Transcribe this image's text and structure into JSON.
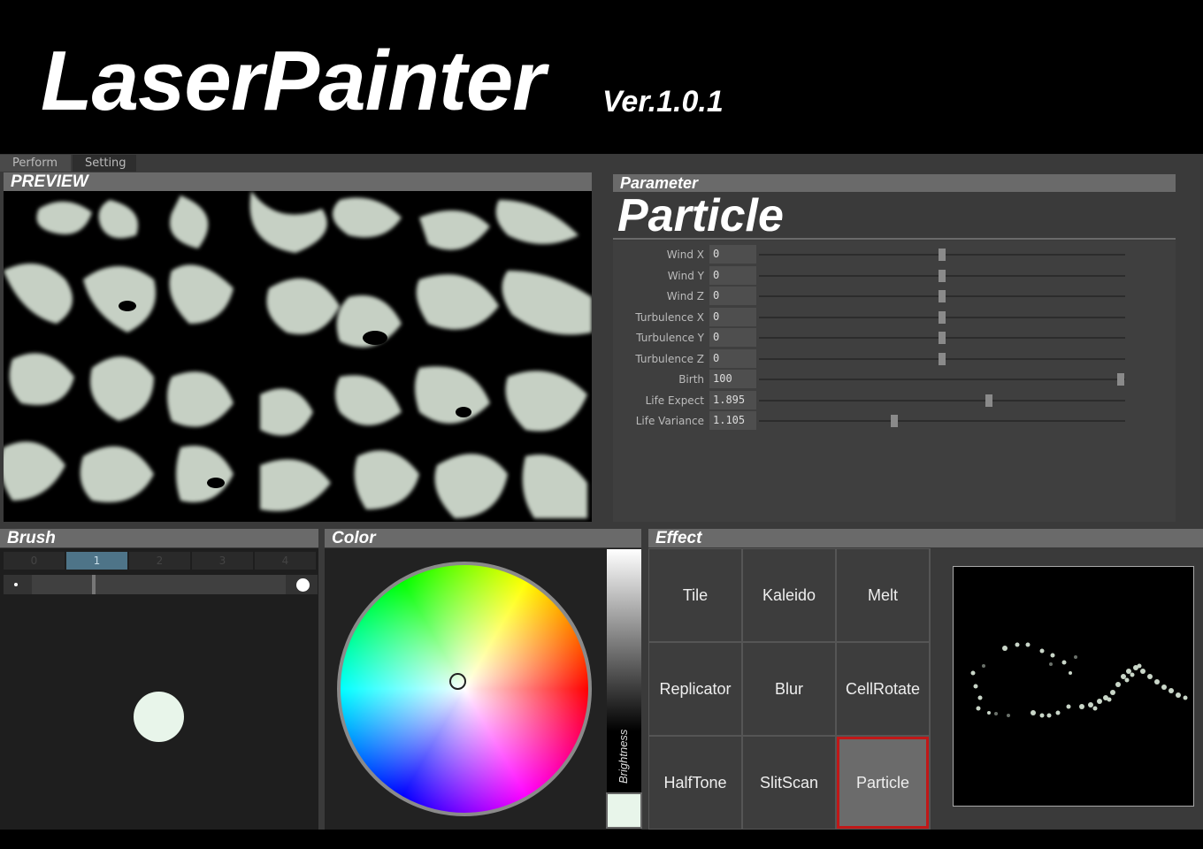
{
  "header": {
    "title": "LaserPainter",
    "version": "Ver.1.0.1"
  },
  "tabs": [
    {
      "label": "Perform"
    },
    {
      "label": "Setting"
    }
  ],
  "preview": {
    "title": "PREVIEW"
  },
  "parameter": {
    "title": "Parameter",
    "effect_name": "Particle",
    "rows": [
      {
        "label": "Wind X",
        "value": "0",
        "level": 0.5
      },
      {
        "label": "Wind Y",
        "value": "0",
        "level": 0.5
      },
      {
        "label": "Wind Z",
        "value": "0",
        "level": 0.5
      },
      {
        "label": "Turbulence X",
        "value": "0",
        "level": 0.5
      },
      {
        "label": "Turbulence Y",
        "value": "0",
        "level": 0.5
      },
      {
        "label": "Turbulence Z",
        "value": "0",
        "level": 0.5
      },
      {
        "label": "Birth",
        "value": "100",
        "level": 1.0
      },
      {
        "label": "Life Expect",
        "value": "1.895",
        "level": 0.63
      },
      {
        "label": "Life Variance",
        "value": "1.105",
        "level": 0.37
      }
    ]
  },
  "brush": {
    "title": "Brush",
    "presets": [
      "0",
      "1",
      "2",
      "3",
      "4"
    ],
    "active_preset": "1",
    "size_level": 0.13,
    "color": "#e8f5ea"
  },
  "color": {
    "title": "Color",
    "brightness_label": "Brightness",
    "selected": "#e8f5ea"
  },
  "effect": {
    "title": "Effect",
    "buttons": [
      "Tile",
      "Kaleido",
      "Melt",
      "Replicator",
      "Blur",
      "CellRotate",
      "HalfTone",
      "SlitScan",
      "Particle"
    ],
    "active": "Particle",
    "active_border_color": "#c01818"
  },
  "theme": {
    "accent": "#4e7488",
    "panel": "#3a3a3a",
    "header": "#6a6a6a"
  }
}
